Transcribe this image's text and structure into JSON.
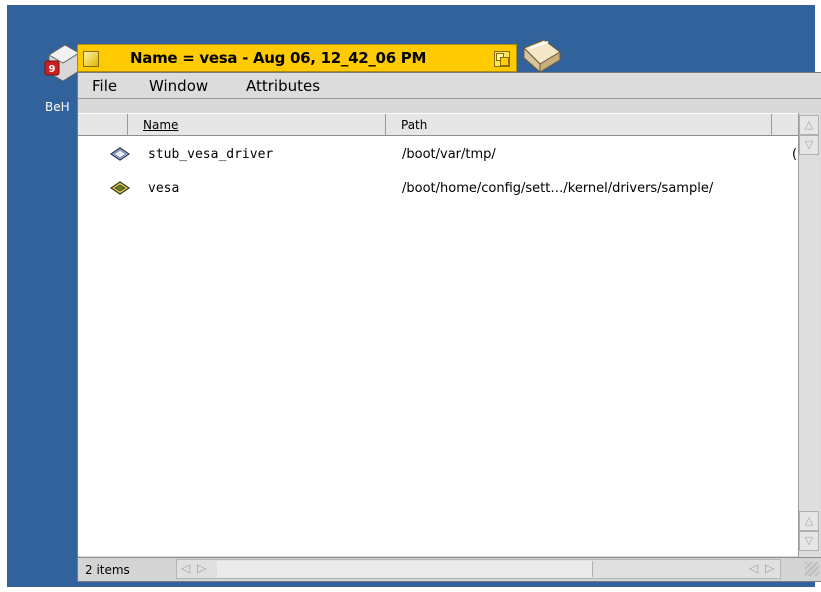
{
  "desktop": {
    "icon_label": "BeH",
    "background_color": "#31629c"
  },
  "window": {
    "title": "Name = vesa - Aug 06, 12_42_06 PM",
    "tab_color": "#ffcb00"
  },
  "menu": {
    "items": [
      "File",
      "Window",
      "Attributes"
    ]
  },
  "columns": {
    "name": "Name",
    "path": "Path"
  },
  "files": [
    {
      "name": "stub_vesa_driver",
      "path": "/boot/var/tmp/",
      "overflow": "(",
      "icon": "driver-icon"
    },
    {
      "name": "vesa",
      "path": "/boot/home/config/sett…/kernel/drivers/sample/",
      "overflow": "",
      "icon": "sample-driver-icon"
    }
  ],
  "status": {
    "count": "2 items"
  }
}
